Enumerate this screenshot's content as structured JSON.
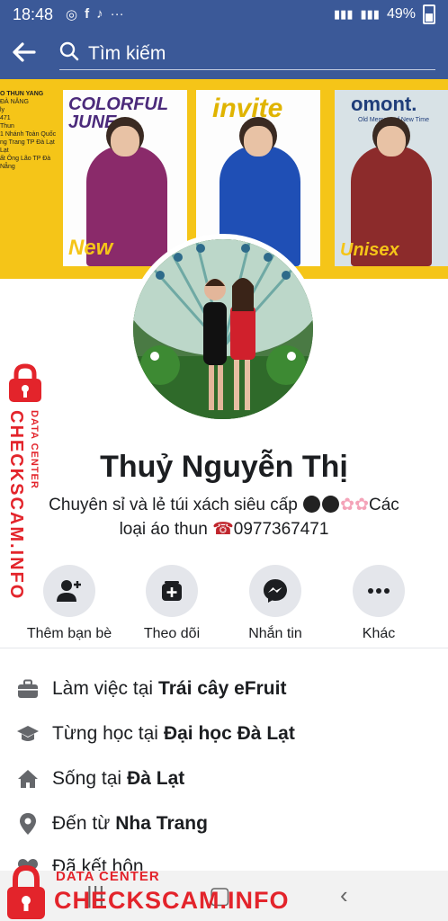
{
  "status": {
    "time": "18:48",
    "battery": "49%",
    "icons": [
      "chrome-icon",
      "facebook-icon",
      "tiktok-icon",
      "more-dots-icon"
    ]
  },
  "search": {
    "placeholder": "Tìm kiếm"
  },
  "cover": {
    "side_text": [
      "O THUN YANG",
      "ĐÀ NẴNG",
      "ly",
      "471",
      "Thun",
      "1 Nhánh Toàn Quốc",
      "ng Trang TP Đà Lạt",
      "Lạt",
      "ất Ông Lão TP Đà Nẵng"
    ],
    "posters": [
      {
        "title": "COLORFUL JUNE",
        "foot": "New"
      },
      {
        "title": "invite",
        "foot": ""
      },
      {
        "title": "omont.",
        "subtitle": "Old Memory of New Time",
        "foot": "Unisex"
      }
    ]
  },
  "profile": {
    "name": "Thuỷ Nguyễn Thị",
    "bio_text": "Chuyên sỉ và lẻ túi xách siêu cấp",
    "bio_text2": "Các",
    "bio_line2": "loại áo thun",
    "phone": "0977367471"
  },
  "actions": [
    {
      "label": "Thêm bạn bè",
      "icon": "add-friend-icon"
    },
    {
      "label": "Theo dõi",
      "icon": "follow-icon"
    },
    {
      "label": "Nhắn tin",
      "icon": "messenger-icon"
    },
    {
      "label": "Khác",
      "icon": "more-icon"
    }
  ],
  "info": [
    {
      "prefix": "Làm việc tại",
      "value": "Trái cây eFruit",
      "icon": "briefcase-icon"
    },
    {
      "prefix": "Từng học tại",
      "value": "Đại học Đà Lạt",
      "icon": "graduation-cap-icon"
    },
    {
      "prefix": "Sống tại",
      "value": "Đà Lạt",
      "icon": "home-icon"
    },
    {
      "prefix": "Đến từ",
      "value": "Nha Trang",
      "icon": "location-pin-icon"
    },
    {
      "prefix": "Đã kết hôn",
      "value": "",
      "icon": "heart-icon"
    }
  ],
  "watermark": {
    "small": "DATA CENTER",
    "big": "CHECKSCAM.INFO"
  },
  "colors": {
    "facebook_blue": "#3b5998",
    "watermark_red": "#e3242b",
    "cover_yellow": "#f5c518"
  }
}
